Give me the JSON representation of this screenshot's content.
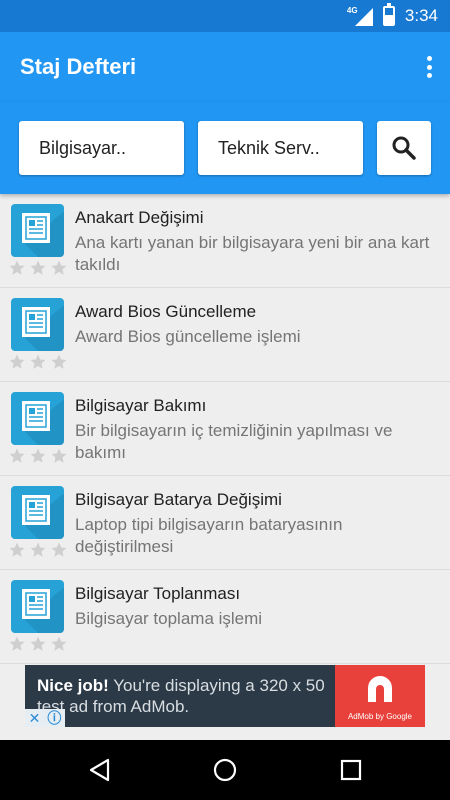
{
  "status_bar": {
    "network": "4G",
    "time": "3:34",
    "battery_level": 0.55,
    "icons": [
      "signal-icon",
      "battery-icon"
    ]
  },
  "app_bar": {
    "title": "Staj Defteri",
    "menu_icon": "overflow-menu-icon"
  },
  "filters": {
    "category": "Bilgisayar..",
    "subcategory": "Teknik Serv..",
    "search_icon": "search-icon"
  },
  "items": [
    {
      "title": "Anakart Değişimi",
      "description": "Ana kartı yanan bir bilgisayara yeni bir ana kart takıldı",
      "rating": 0
    },
    {
      "title": "Award Bios Güncelleme",
      "description": "Award Bios güncelleme işlemi",
      "rating": 0
    },
    {
      "title": "Bilgisayar Bakımı",
      "description": "Bir bilgisayarın iç temizliğinin yapılması ve bakımı",
      "rating": 0
    },
    {
      "title": "Bilgisayar Batarya Değişimi",
      "description": "Laptop tipi bilgisayarın bataryasının değiştirilmesi",
      "rating": 0
    },
    {
      "title": "Bilgisayar Toplanması",
      "description": "Bilgisayar toplama işlemi",
      "rating": 0
    }
  ],
  "ad": {
    "headline": "Nice job!",
    "body": " You're displaying a 320 x 50 test ad from AdMob.",
    "brand": "AdMob by Google",
    "close_glyph": "✕",
    "info_glyph": "ⓘ"
  },
  "colors": {
    "primary": "#2196f3",
    "primary_dark": "#1779d2",
    "icon_bg": "#26a2d6",
    "ad_bg": "#2b3a46",
    "ad_accent": "#e8403a"
  }
}
